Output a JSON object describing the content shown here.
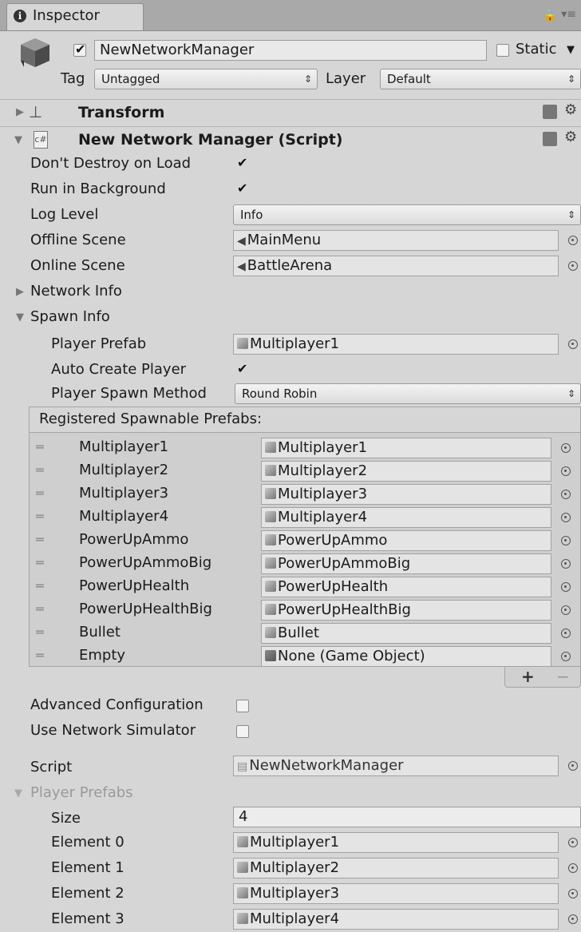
{
  "tab": {
    "icon": "info-icon",
    "title": "Inspector"
  },
  "header": {
    "object_name": "NewNetworkManager",
    "active": true,
    "static_label": "Static",
    "static": false,
    "tag_label": "Tag",
    "tag_value": "Untagged",
    "layer_label": "Layer",
    "layer_value": "Default"
  },
  "components": {
    "transform": {
      "title": "Transform"
    },
    "script": {
      "title": "New Network Manager (Script)"
    }
  },
  "fields": {
    "dont_destroy": {
      "label": "Don't Destroy on Load",
      "checked": true
    },
    "run_background": {
      "label": "Run in Background",
      "checked": true
    },
    "log_level": {
      "label": "Log Level",
      "value": "Info"
    },
    "offline_scene": {
      "label": "Offline Scene",
      "value": "MainMenu"
    },
    "online_scene": {
      "label": "Online Scene",
      "value": "BattleArena"
    },
    "network_info": {
      "label": "Network Info"
    },
    "spawn_info": {
      "label": "Spawn Info"
    },
    "player_prefab": {
      "label": "Player Prefab",
      "value": "Multiplayer1"
    },
    "auto_create": {
      "label": "Auto Create Player",
      "checked": true
    },
    "spawn_method": {
      "label": "Player Spawn Method",
      "value": "Round Robin"
    },
    "advanced": {
      "label": "Advanced Configuration",
      "checked": false
    },
    "simulator": {
      "label": "Use Network Simulator",
      "checked": false
    },
    "script": {
      "label": "Script",
      "value": "NewNetworkManager"
    },
    "player_prefabs": {
      "label": "Player Prefabs"
    },
    "size": {
      "label": "Size",
      "value": "4"
    }
  },
  "spawnables": {
    "header": "Registered Spawnable Prefabs:",
    "items": [
      {
        "name": "Multiplayer1",
        "value": "Multiplayer1"
      },
      {
        "name": "Multiplayer2",
        "value": "Multiplayer2"
      },
      {
        "name": "Multiplayer3",
        "value": "Multiplayer3"
      },
      {
        "name": "Multiplayer4",
        "value": "Multiplayer4"
      },
      {
        "name": "PowerUpAmmo",
        "value": "PowerUpAmmo"
      },
      {
        "name": "PowerUpAmmoBig",
        "value": "PowerUpAmmoBig"
      },
      {
        "name": "PowerUpHealth",
        "value": "PowerUpHealth"
      },
      {
        "name": "PowerUpHealthBig",
        "value": "PowerUpHealthBig"
      },
      {
        "name": "Bullet",
        "value": "Bullet"
      },
      {
        "name": "Empty",
        "value": "None (Game Object)"
      }
    ],
    "add": "+",
    "remove": "−"
  },
  "elements": [
    {
      "label": "Element 0",
      "value": "Multiplayer1"
    },
    {
      "label": "Element 1",
      "value": "Multiplayer2"
    },
    {
      "label": "Element 2",
      "value": "Multiplayer3"
    },
    {
      "label": "Element 3",
      "value": "Multiplayer4"
    }
  ]
}
